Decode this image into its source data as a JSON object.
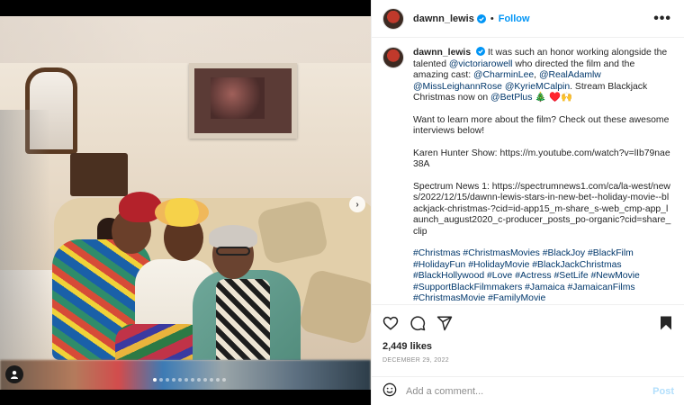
{
  "header": {
    "username": "dawnn_lewis",
    "separator": "•",
    "follow_label": "Follow",
    "more_label": "•••"
  },
  "caption": {
    "username": "dawnn_lewis",
    "text_1": "It was such an honor working alongside the talented",
    "mention_1": "@victoriarowell",
    "text_2": "who directed the film and the amazing cast:",
    "mention_2": "@CharminLee",
    "mention_3": "@RealAdamlw",
    "mention_4": "@MissLeighannRose",
    "mention_5": "@KyrieMCalpin",
    "text_3": ". Stream Blackjack Christmas now on",
    "mention_6": "@BetPlus",
    "emoji_line": "🎄 ♥️🙌",
    "para_2": "Want to learn more about the film? Check out these awesome interviews below!",
    "para_3": "Karen Hunter Show: https://m.youtube.com/watch?v=lIb79nae38A",
    "para_4": "Spectrum News 1: https://spectrumnews1.com/ca/la-west/news/2022/12/15/dawnn-lewis-stars-in-new-bet--holiday-movie--blackjack-christmas-?cid=id-app15_m-share_s-web_cmp-app_launch_august2020_c-producer_posts_po-organic?cid=share_clip",
    "hashtags": "#Christmas #ChristmasMovies #BlackJoy #BlackFilm #HolidayFun #HolidayMovie #BlackJackChristmas #BlackHollywood #Love #Actress #SetLife #NewMovie #SupportBlackFilmmakers #Jamaica #JamaicanFilms #ChristmasMovie #FamilyMovie"
  },
  "actions": {
    "likes": "2,449 likes",
    "date": "DECEMBER 29, 2022"
  },
  "comment": {
    "placeholder": "Add a comment...",
    "post_label": "Post"
  },
  "carousel": {
    "next_label": "›",
    "dot_count": 12,
    "active_index": 0
  },
  "colors": {
    "accent": "#0095f6",
    "link": "#00376b",
    "muted": "#8e8e8e",
    "post_disabled": "#b2dffc"
  }
}
